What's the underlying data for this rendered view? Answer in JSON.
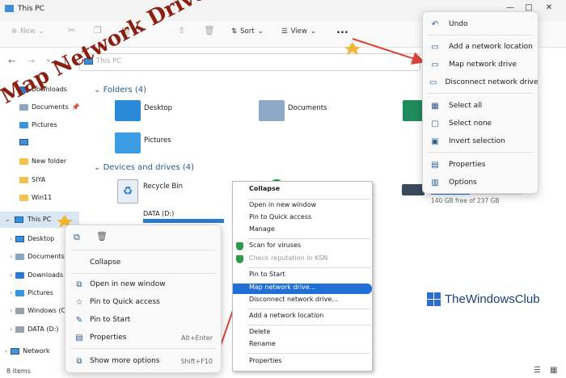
{
  "window": {
    "title": "This PC",
    "controls": [
      "—",
      "□",
      "✕"
    ]
  },
  "toolbar": {
    "new_label": "New",
    "sort_label": "Sort",
    "view_label": "View",
    "more_label": "..."
  },
  "address": {
    "text": "This PC"
  },
  "sidebar": {
    "items": [
      {
        "label": "Downloads"
      },
      {
        "label": "Documents"
      },
      {
        "label": "Pictures"
      },
      {
        "label": ""
      },
      {
        "label": "New folder"
      },
      {
        "label": "SIYA"
      },
      {
        "label": "Win11"
      },
      {
        "label": "This PC"
      },
      {
        "label": "Desktop"
      },
      {
        "label": "Documents"
      },
      {
        "label": "Downloads"
      },
      {
        "label": "Pictures"
      },
      {
        "label": "Windows (C:)"
      },
      {
        "label": "DATA (D:)"
      },
      {
        "label": "Network"
      }
    ]
  },
  "main": {
    "folders_header": "Folders (4)",
    "folders": [
      "Desktop",
      "Documents",
      "Pictures"
    ],
    "devices_header": "Devices and drives (4)",
    "recycle": "Recycle Bin",
    "data_drive": "DATA (D:)",
    "drive_free": "140 GB free of 237 GB"
  },
  "more_menu": {
    "items": [
      "Undo",
      "Add a network location",
      "Map network drive",
      "Disconnect network drive",
      "Select all",
      "Select none",
      "Invert selection",
      "Properties",
      "Options"
    ]
  },
  "context_menu": {
    "items": [
      "Collapse",
      "Open in new window",
      "Pin to Quick access",
      "Pin to Start",
      "Properties",
      "Show more options"
    ],
    "shortcuts": {
      "properties": "Alt+Enter",
      "more": "Shift+F10"
    }
  },
  "classic_menu": {
    "items": [
      "Collapse",
      "Open in new window",
      "Pin to Quick access",
      "Manage",
      "Scan for viruses",
      "Check reputation in KSN",
      "Pin to Start",
      "Map network drive...",
      "Disconnect network drive...",
      "Add a network location",
      "Delete",
      "Rename",
      "Properties"
    ]
  },
  "overlay": {
    "headline": "Map Network Drive",
    "brand": "TheWindowsClub"
  },
  "status": {
    "items": "8 items"
  },
  "colors": {
    "accent": "#1f6fd6",
    "headline": "#8a1f12",
    "arrow": "#d9443a"
  }
}
